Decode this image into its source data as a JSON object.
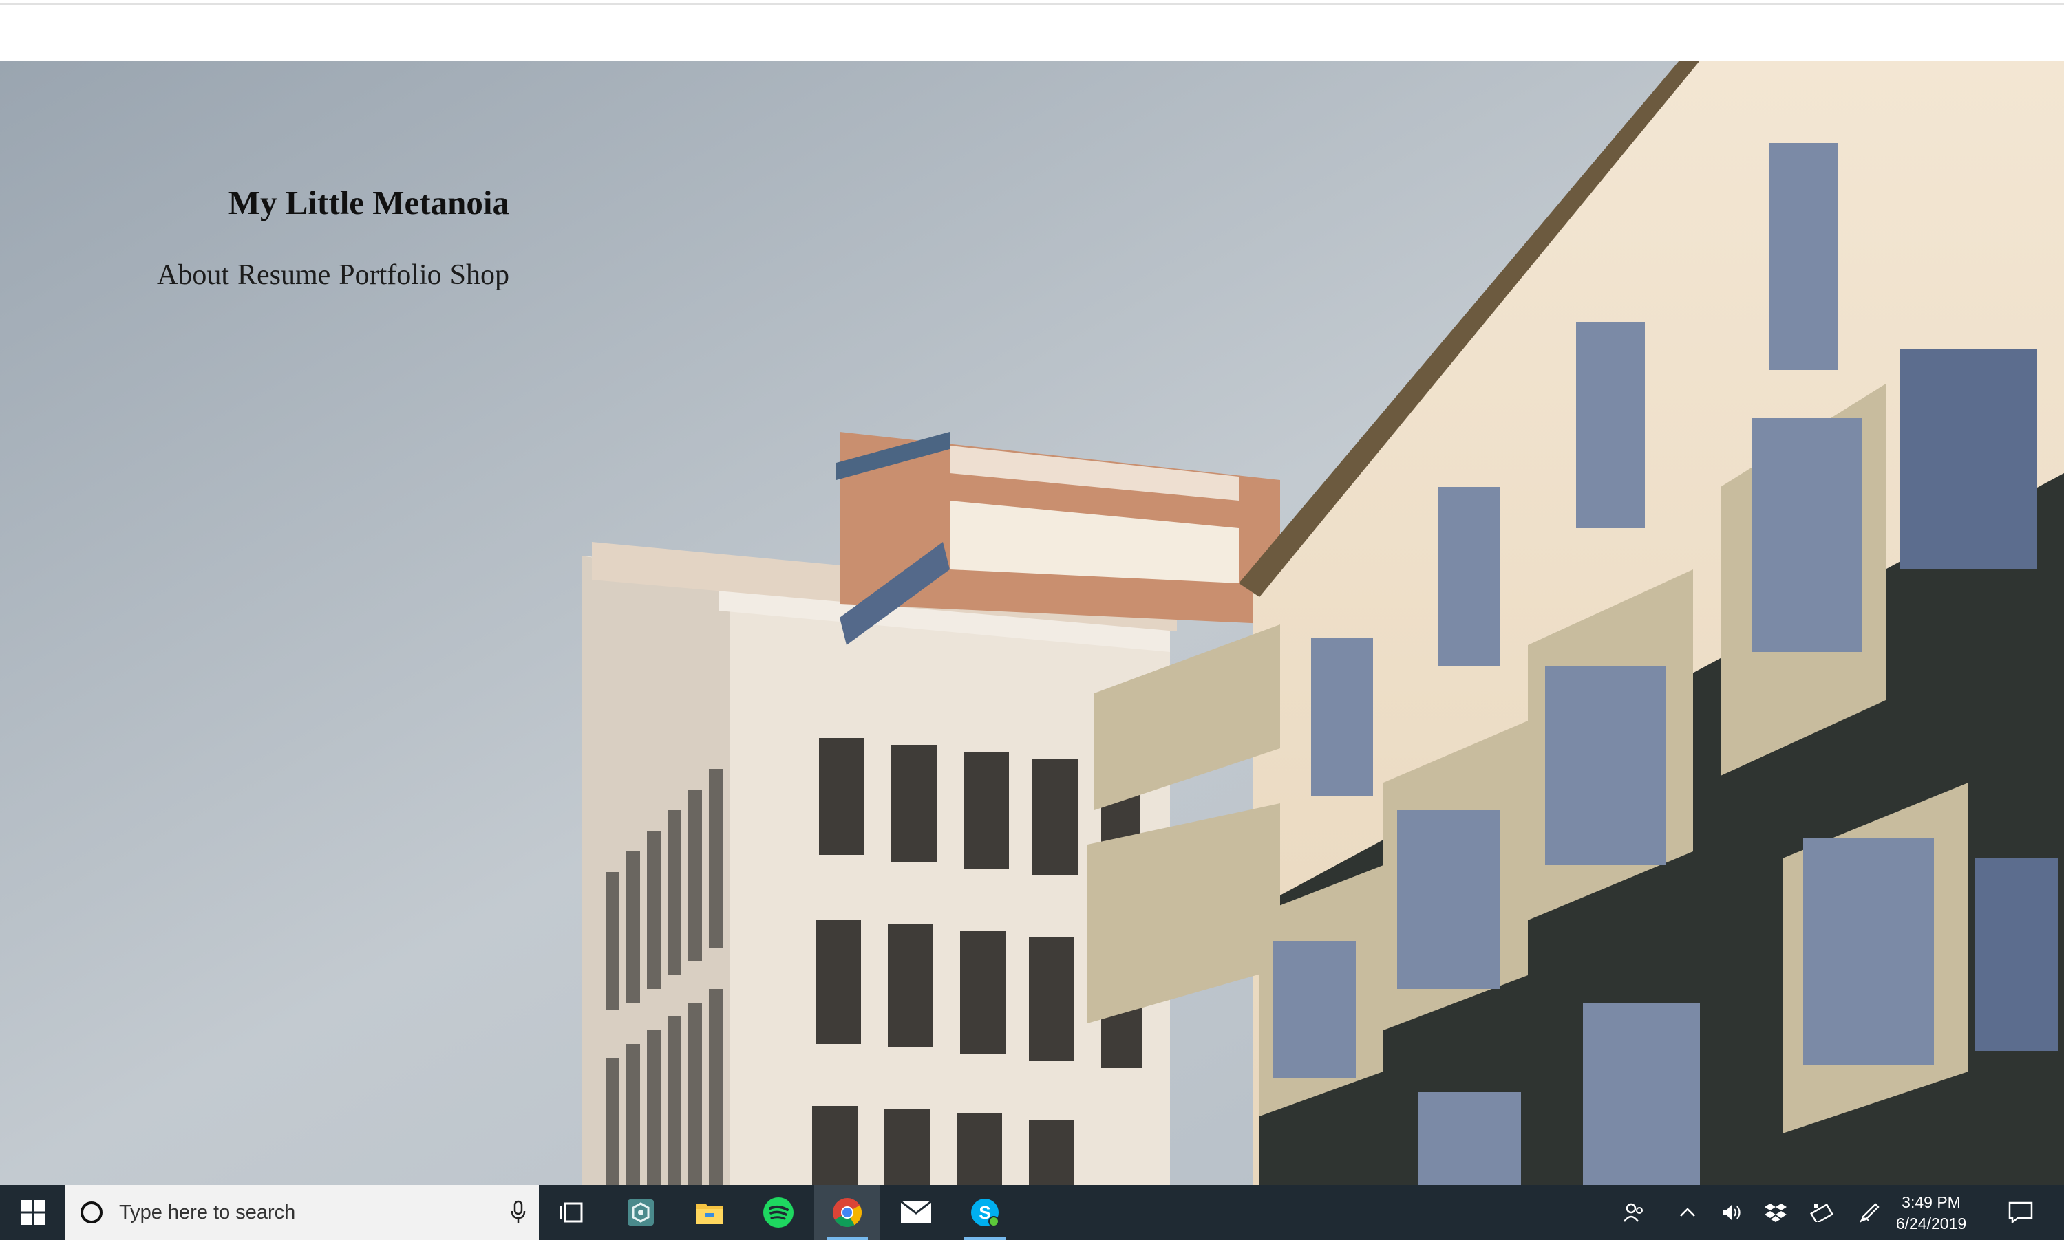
{
  "site": {
    "title": "My Little Metanoia",
    "nav": [
      "About",
      "Resume",
      "Portfolio",
      "Shop"
    ]
  },
  "taskbar": {
    "search_placeholder": "Type here to search",
    "pinned_icons": [
      "task-view-icon",
      "app-hex-icon",
      "file-explorer-icon",
      "spotify-icon",
      "chrome-icon",
      "mail-icon",
      "skype-icon"
    ],
    "active_app": "chrome-icon",
    "clock": {
      "time": "3:49 PM",
      "date": "6/24/2019"
    },
    "tray_icons": [
      "people-icon",
      "chevron-up-icon",
      "volume-icon",
      "dropbox-icon",
      "battery-icon",
      "pen-icon",
      "notification-icon"
    ],
    "colors": {
      "background": "#1f2a33",
      "accent": "#76b9ed"
    }
  }
}
